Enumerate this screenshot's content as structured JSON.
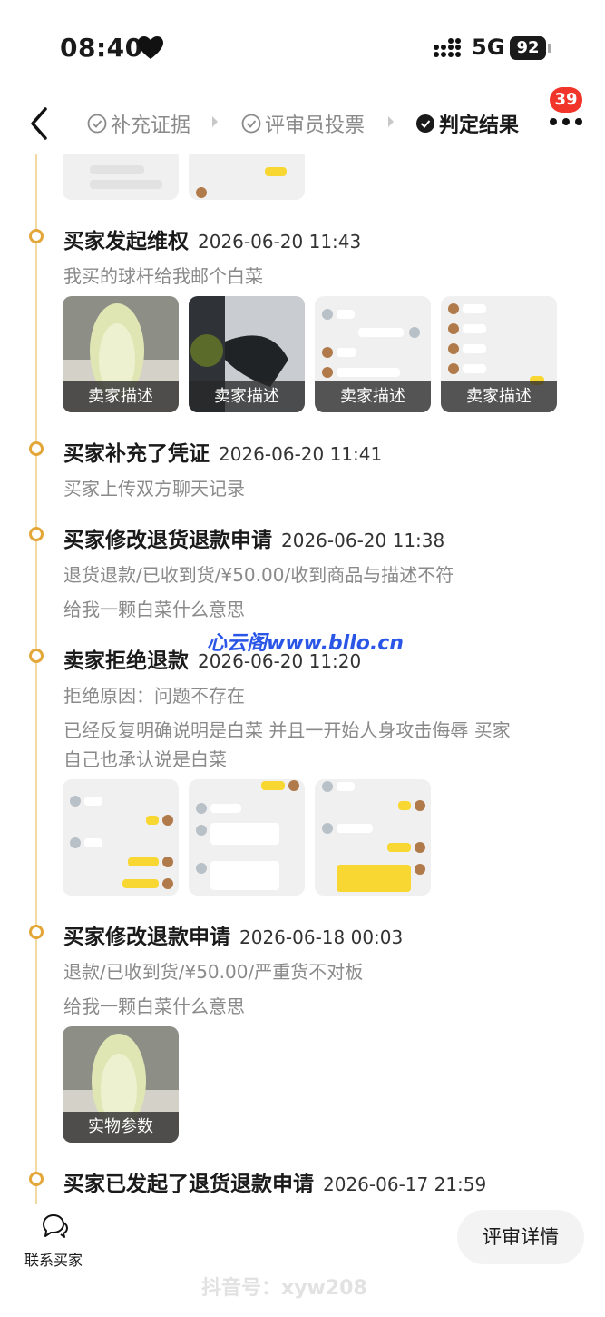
{
  "status": {
    "time": "08:40",
    "network": "5G",
    "battery": "92"
  },
  "nav": {
    "steps": [
      {
        "label": "补充证据"
      },
      {
        "label": "评审员投票"
      },
      {
        "label": "判定结果"
      }
    ],
    "badge": "39"
  },
  "timeline": [
    {
      "title": "买家发起维权",
      "time": "2026-06-20 11:43",
      "text": "我买的球杆给我邮个白菜",
      "images": [
        "卖家描述",
        "卖家描述",
        "卖家描述",
        "卖家描述"
      ]
    },
    {
      "title": "买家补充了凭证",
      "time": "2026-06-20 11:41",
      "text": "买家上传双方聊天记录"
    },
    {
      "title": "买家修改退货退款申请",
      "time": "2026-06-20 11:38",
      "text": "退货退款/已收到货/¥50.00/收到商品与描述不符",
      "text2": "给我一颗白菜什么意思"
    },
    {
      "title": "卖家拒绝退款",
      "time": "2026-06-20 11:20",
      "text": "拒绝原因：问题不存在",
      "text2": "已经反复明确说明是白菜 并且一开始人身攻击侮辱 买家",
      "text3": "自己也承认说是白菜"
    },
    {
      "title": "买家修改退款申请",
      "time": "2026-06-18 00:03",
      "text": "退款/已收到货/¥50.00/严重货不对板",
      "text2": "给我一颗白菜什么意思",
      "images": [
        "实物参数"
      ]
    },
    {
      "title": "买家已发起了退货退款申请",
      "time": "2026-06-17 21:59"
    }
  ],
  "watermark": "心云阁www.bllo.cn",
  "bottom": {
    "contact": "联系买家",
    "review": "评审详情"
  },
  "douyin": "抖音号：xyw208"
}
